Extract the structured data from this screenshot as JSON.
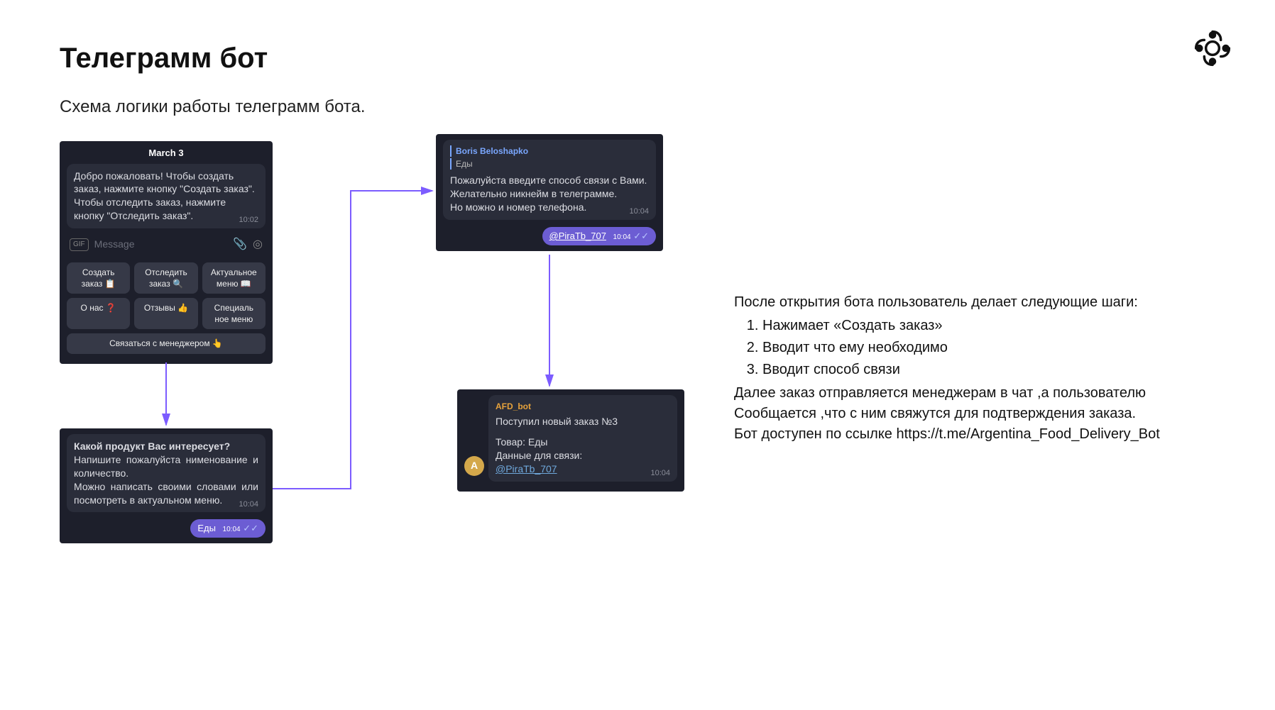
{
  "title": "Телеграмм бот",
  "subtitle": "Схема логики работы телеграмм бота.",
  "screen1": {
    "date": "March 3",
    "welcome": "Добро пожаловать! Чтобы создать заказ, нажмите кнопку \"Создать заказ\".\nЧтобы отследить заказ, нажмите кнопку \"Отследить заказ\".",
    "welcome_time": "10:02",
    "input_placeholder": "Message",
    "gif_label": "GIF",
    "kb": [
      "Создать\nзаказ 📋",
      "Отследить\nзаказ 🔍",
      "Актуальное\nменю 📖",
      "О нас ❓",
      "Отзывы 👍",
      "Специаль\nное меню"
    ],
    "kb_wide": "Связаться с менеджером 👆"
  },
  "screen2": {
    "title": "Какой продукт Вас интересует?",
    "body": "Напишите пожалуйста нименование и количество.\nМожно написать своими словами или посмотреть в актуальном меню.",
    "time": "10:04",
    "reply_text": "Еды",
    "reply_time": "10:04"
  },
  "screen3": {
    "reply_name": "Boris Beloshapko",
    "reply_quote": "Еды",
    "body": "Пожалуйста введите способ связи с Вами.\nЖелательно никнейм в телеграмме.\nНо можно и номер телефона.",
    "time": "10:04",
    "reply_text": "@PiraTb_707",
    "reply_time": "10:04"
  },
  "screen4": {
    "bot_name": "AFD_bot",
    "line1": "Поступил новый заказ №3",
    "line2": "Товар: Еды",
    "line3": "Данные для связи:",
    "link": "@PiraTb_707",
    "time": "10:04",
    "avatar_letter": "A"
  },
  "explain": {
    "intro": "После открытия бота пользователь делает следующие шаги:",
    "steps": [
      "Нажимает «Создать заказ»",
      "Вводит что ему необходимо",
      "Вводит способ связи"
    ],
    "p1": "Далее заказ отправляется менеджерам в чат  ,а пользователю",
    "p2": "Сообщается ,что с ним свяжутся для подтверждения заказа.",
    "p3": "Бот доступен по ссылке https://t.me/Argentina_Food_Delivery_Bot"
  }
}
